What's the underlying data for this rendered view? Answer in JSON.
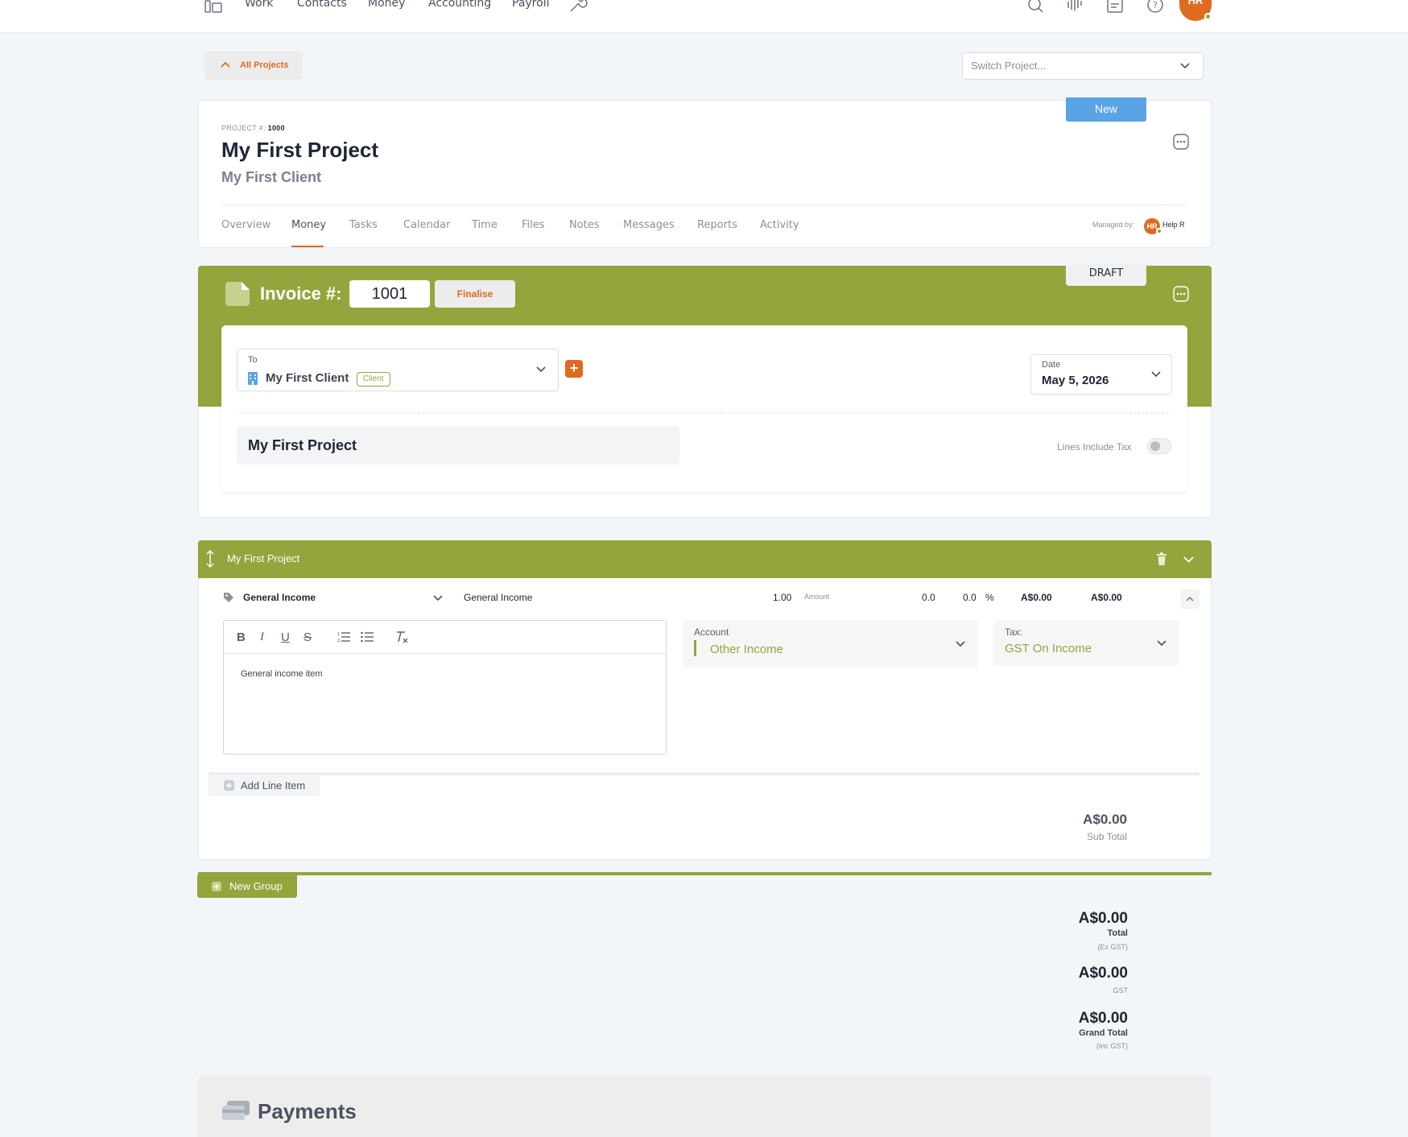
{
  "nav": {
    "items": [
      "Work",
      "Contacts",
      "Money",
      "Accounting",
      "Payroll"
    ],
    "avatar_initials": "HR"
  },
  "back": {
    "label": "All Projects"
  },
  "switch_project": {
    "placeholder": "Switch Project..."
  },
  "project": {
    "number_label": "PROJECT #:",
    "number": "1000",
    "title": "My First Project",
    "client": "My First Client",
    "new_label": "New",
    "tabs": [
      "Overview",
      "Money",
      "Tasks",
      "Calendar",
      "Time",
      "Files",
      "Notes",
      "Messages",
      "Reports",
      "Activity"
    ],
    "active_tab": "Money",
    "managed_label": "Managed by:",
    "manager_initials": "HR",
    "manager_name": "Help R"
  },
  "invoice": {
    "label": "Invoice #:",
    "number": "1001",
    "finalise_label": "Finalise",
    "status": "DRAFT",
    "to_label": "To",
    "to_value": "My First Client",
    "to_badge": "Client",
    "date_label": "Date",
    "date_value": "May 5, 2026",
    "project_name": "My First Project",
    "lines_include_tax_label": "Lines Include Tax",
    "lines_include_tax": false
  },
  "group": {
    "title": "My First Project",
    "line": {
      "item": "General Income",
      "description": "General Income",
      "qty": "1.00",
      "amount_label": "Amount",
      "amount": "0.0",
      "discount": "0.0",
      "discount_unit": "%",
      "subtotal": "A$0.00",
      "total": "A$0.00",
      "note": "General income item",
      "account_label": "Account",
      "account_value": "Other Income",
      "tax_label": "Tax:",
      "tax_value": "GST On Income"
    },
    "add_line_label": "Add Line Item",
    "sub_total_value": "A$0.00",
    "sub_total_label": "Sub Total"
  },
  "new_group_label": "New Group",
  "totals": {
    "total_value": "A$0.00",
    "total_label": "Total",
    "total_sub": "(Ex GST)",
    "gst_value": "A$0.00",
    "gst_label": "GST",
    "grand_value": "A$0.00",
    "grand_label": "Grand Total",
    "grand_sub": "(Inc GST)"
  },
  "payments": {
    "title": "Payments"
  },
  "colors": {
    "accent": "#dd6b20",
    "green": "#95a53d",
    "blue": "#5aa3e6"
  }
}
